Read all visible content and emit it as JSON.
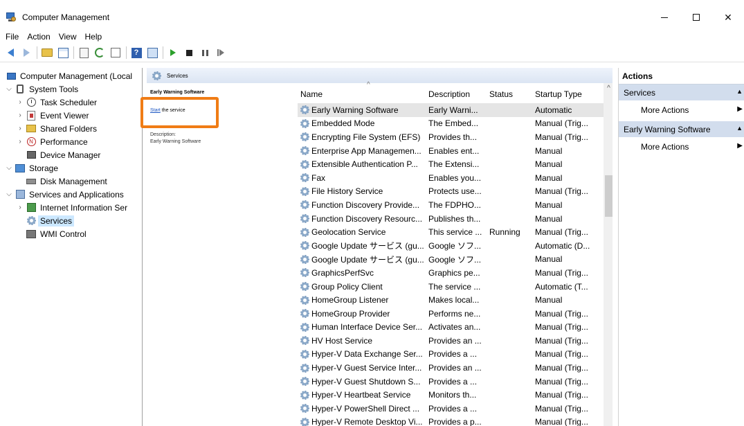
{
  "window": {
    "title": "Computer Management"
  },
  "menu": [
    "File",
    "Action",
    "View",
    "Help"
  ],
  "toolbar": {
    "icons": [
      "back-icon",
      "forward-icon",
      "up-folder-icon",
      "show-hide-tree-icon",
      "properties-icon",
      "refresh-icon",
      "export-list-icon",
      "help-icon",
      "show-console-icon",
      "start-service-icon",
      "stop-service-icon",
      "pause-service-icon",
      "resume-service-icon"
    ]
  },
  "tree": {
    "items": [
      {
        "label": "Computer Management (Local",
        "depth": 0,
        "chev": "",
        "icon": "computer-icon"
      },
      {
        "label": "System Tools",
        "depth": 1,
        "chev": "expanded",
        "icon": "tools-icon"
      },
      {
        "label": "Task Scheduler",
        "depth": 2,
        "chev": "collapsed",
        "icon": "clock-icon"
      },
      {
        "label": "Event Viewer",
        "depth": 2,
        "chev": "collapsed",
        "icon": "event-viewer-icon"
      },
      {
        "label": "Shared Folders",
        "depth": 2,
        "chev": "collapsed",
        "icon": "shared-folder-icon"
      },
      {
        "label": "Performance",
        "depth": 2,
        "chev": "collapsed",
        "icon": "performance-icon"
      },
      {
        "label": "Device Manager",
        "depth": 2,
        "chev": "",
        "icon": "device-manager-icon"
      },
      {
        "label": "Storage",
        "depth": 1,
        "chev": "expanded",
        "icon": "storage-icon"
      },
      {
        "label": "Disk Management",
        "depth": 2,
        "chev": "",
        "icon": "disk-icon"
      },
      {
        "label": "Services and Applications",
        "depth": 1,
        "chev": "expanded",
        "icon": "services-apps-icon"
      },
      {
        "label": "Internet Information Ser",
        "depth": 2,
        "chev": "collapsed",
        "icon": "iis-icon"
      },
      {
        "label": "Services",
        "depth": 2,
        "chev": "",
        "icon": "services-gear-icon",
        "selected": true
      },
      {
        "label": "WMI Control",
        "depth": 2,
        "chev": "",
        "icon": "wmi-icon"
      }
    ]
  },
  "services_header": {
    "label": "Services"
  },
  "description_pane": {
    "title": "Early Warning Software",
    "start_link": "Start",
    "start_rest": " the service",
    "description_label": "Description:",
    "description_value": "Early Warning Software"
  },
  "list": {
    "columns": [
      "Name",
      "Description",
      "Status",
      "Startup Type"
    ],
    "rows": [
      {
        "name": "Early Warning Software",
        "description": "Early Warni...",
        "status": "",
        "startup": "Automatic",
        "selected": true
      },
      {
        "name": "Embedded Mode",
        "description": "The Embed...",
        "status": "",
        "startup": "Manual (Trig..."
      },
      {
        "name": "Encrypting File System (EFS)",
        "description": "Provides th...",
        "status": "",
        "startup": "Manual (Trig..."
      },
      {
        "name": "Enterprise App Managemen...",
        "description": "Enables ent...",
        "status": "",
        "startup": "Manual"
      },
      {
        "name": "Extensible Authentication P...",
        "description": "The Extensi...",
        "status": "",
        "startup": "Manual"
      },
      {
        "name": "Fax",
        "description": "Enables you...",
        "status": "",
        "startup": "Manual"
      },
      {
        "name": "File History Service",
        "description": "Protects use...",
        "status": "",
        "startup": "Manual (Trig..."
      },
      {
        "name": "Function Discovery Provide...",
        "description": "The FDPHO...",
        "status": "",
        "startup": "Manual"
      },
      {
        "name": "Function Discovery Resourc...",
        "description": "Publishes th...",
        "status": "",
        "startup": "Manual"
      },
      {
        "name": "Geolocation Service",
        "description": "This service ...",
        "status": "Running",
        "startup": "Manual (Trig..."
      },
      {
        "name": "Google Update サービス (gu...",
        "description": "Google ソフ...",
        "status": "",
        "startup": "Automatic (D..."
      },
      {
        "name": "Google Update サービス (gu...",
        "description": "Google ソフ...",
        "status": "",
        "startup": "Manual"
      },
      {
        "name": "GraphicsPerfSvc",
        "description": "Graphics pe...",
        "status": "",
        "startup": "Manual (Trig..."
      },
      {
        "name": "Group Policy Client",
        "description": "The service ...",
        "status": "",
        "startup": "Automatic (T..."
      },
      {
        "name": "HomeGroup Listener",
        "description": "Makes local...",
        "status": "",
        "startup": "Manual"
      },
      {
        "name": "HomeGroup Provider",
        "description": "Performs ne...",
        "status": "",
        "startup": "Manual (Trig..."
      },
      {
        "name": "Human Interface Device Ser...",
        "description": "Activates an...",
        "status": "",
        "startup": "Manual (Trig..."
      },
      {
        "name": "HV Host Service",
        "description": "Provides an ...",
        "status": "",
        "startup": "Manual (Trig..."
      },
      {
        "name": "Hyper-V Data Exchange Ser...",
        "description": "Provides a ...",
        "status": "",
        "startup": "Manual (Trig..."
      },
      {
        "name": "Hyper-V Guest Service Inter...",
        "description": "Provides an ...",
        "status": "",
        "startup": "Manual (Trig..."
      },
      {
        "name": "Hyper-V Guest Shutdown S...",
        "description": "Provides a ...",
        "status": "",
        "startup": "Manual (Trig..."
      },
      {
        "name": "Hyper-V Heartbeat Service",
        "description": "Monitors th...",
        "status": "",
        "startup": "Manual (Trig..."
      },
      {
        "name": "Hyper-V PowerShell Direct ...",
        "description": "Provides a ...",
        "status": "",
        "startup": "Manual (Trig..."
      },
      {
        "name": "Hyper-V Remote Desktop Vi...",
        "description": "Provides a p...",
        "status": "",
        "startup": "Manual (Trig..."
      }
    ]
  },
  "actions": {
    "title": "Actions",
    "sections": [
      {
        "label": "Services",
        "items": [
          "More Actions"
        ]
      },
      {
        "label": "Early Warning Software",
        "items": [
          "More Actions"
        ]
      }
    ]
  },
  "colors": {
    "highlight_box": "#f07c15",
    "selected_tree_bg": "#cce8ff",
    "actions_section_bg": "#d2dded",
    "link": "#1a55c2"
  }
}
